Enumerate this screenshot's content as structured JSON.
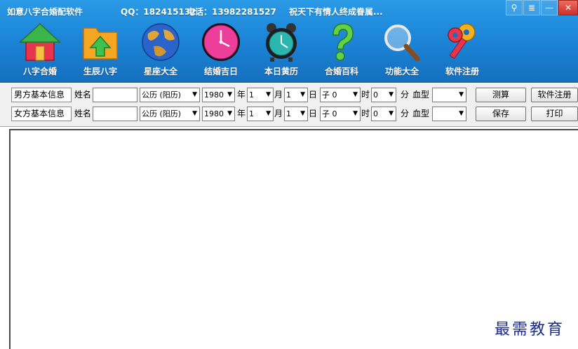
{
  "titlebar": {
    "app_title": "如意八字合婚配软件",
    "qq": "QQ：182415132",
    "phone": "电话：13982281527",
    "slogan": "祝天下有情人终成眷属..."
  },
  "window_controls": {
    "pin": "⚲",
    "menu": "≣",
    "minimize": "—",
    "close": "✕"
  },
  "toolbar": {
    "items": [
      {
        "label": "八字合婚",
        "icon": "house-icon"
      },
      {
        "label": "生辰八字",
        "icon": "folder-up-icon"
      },
      {
        "label": "星座大全",
        "icon": "globe-icon"
      },
      {
        "label": "结婚吉日",
        "icon": "clock-icon"
      },
      {
        "label": "本日黄历",
        "icon": "alarm-clock-icon"
      },
      {
        "label": "合婚百科",
        "icon": "question-icon"
      },
      {
        "label": "功能大全",
        "icon": "magnifier-icon"
      },
      {
        "label": "软件注册",
        "icon": "keys-icon"
      }
    ]
  },
  "form": {
    "male": {
      "label": "男方基本信息",
      "name_label": "姓名",
      "name_value": "",
      "calendar": "公历 (阳历)",
      "year": "1980",
      "year_unit": "年",
      "month": "1",
      "month_unit": "月",
      "day": "1",
      "day_unit": "日",
      "hour": "子 0",
      "hour_unit": "时",
      "minute": "0",
      "minute_unit": "分",
      "blood_label": "血型",
      "blood_value": "",
      "btn1": "测算",
      "btn2": "软件注册"
    },
    "female": {
      "label": "女方基本信息",
      "name_label": "姓名",
      "name_value": "",
      "calendar": "公历 (阳历)",
      "year": "1980",
      "year_unit": "年",
      "month": "1",
      "month_unit": "月",
      "day": "1",
      "day_unit": "日",
      "hour": "子 0",
      "hour_unit": "时",
      "minute": "0",
      "minute_unit": "分",
      "blood_label": "血型",
      "blood_value": "",
      "btn1": "保存",
      "btn2": "打印"
    }
  },
  "watermark": "最需教育",
  "colors": {
    "header_top": "#2a9ae6",
    "header_bottom": "#166fbf",
    "close_red": "#c9302c",
    "watermark": "#1b2a88"
  }
}
